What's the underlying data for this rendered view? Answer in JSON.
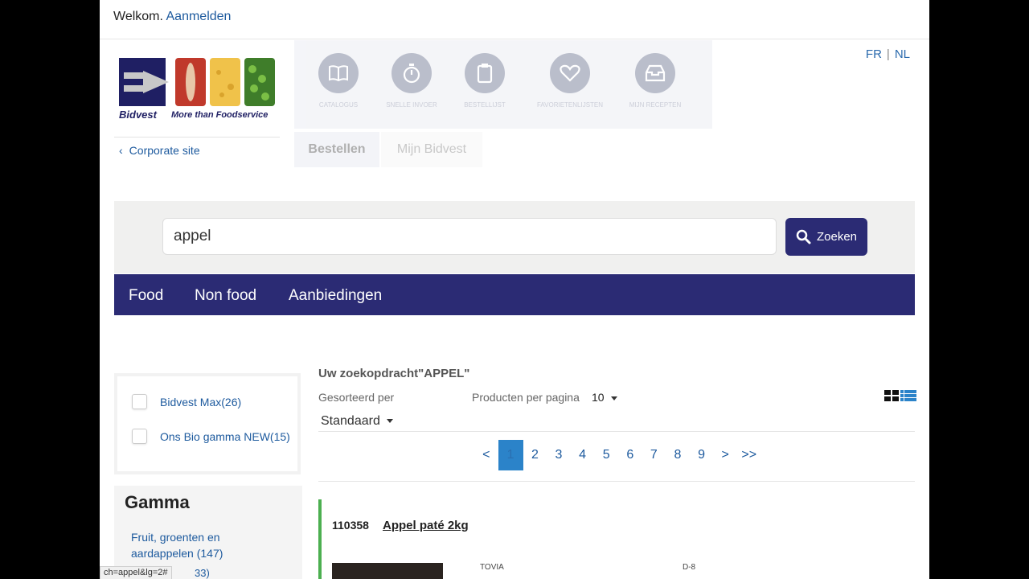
{
  "header": {
    "welcome": "Welkom.",
    "login_link": "Aanmelden"
  },
  "language": {
    "fr": "FR",
    "nl": "NL"
  },
  "logo": {
    "brand": "Bidvest",
    "tagline": "More than Foodservice"
  },
  "corporate_link": "Corporate site",
  "main_nav": [
    {
      "label": "CATALOGUS",
      "icon": "book-icon"
    },
    {
      "label": "SNELLE INVOER",
      "icon": "stopwatch-icon"
    },
    {
      "label": "BESTELLIJST",
      "icon": "clipboard-icon"
    },
    {
      "label": "FAVORIETENLIJSTEN",
      "icon": "heart-icon"
    },
    {
      "label": "MIJN RECEPTEN",
      "icon": "inbox-icon"
    }
  ],
  "tabs": {
    "order": "Bestellen",
    "my_account": "Mijn Bidvest"
  },
  "search": {
    "value": "appel",
    "button": "Zoeken"
  },
  "categories": [
    "Food",
    "Non food",
    "Aanbiedingen"
  ],
  "filters": [
    {
      "label": "Bidvest Max(26)",
      "checked": false
    },
    {
      "label": "Ons Bio gamma NEW(15)",
      "checked": false
    }
  ],
  "gamma": {
    "title": "Gamma",
    "items": [
      "Fruit, groenten en aardappelen (147)",
      "33)"
    ]
  },
  "results": {
    "title": "Uw zoekopdracht\"APPEL\"",
    "sort_label": "Gesorteerd per",
    "sort_value": "Standaard",
    "per_page_label": "Producten per pagina",
    "per_page_value": "10"
  },
  "pagination": {
    "prev": "<",
    "pages": [
      "1",
      "2",
      "3",
      "4",
      "5",
      "6",
      "7",
      "8",
      "9"
    ],
    "next": ">",
    "last": ">>",
    "active": "1"
  },
  "product": {
    "code": "110358",
    "name": "Appel paté 2kg",
    "brand": "TOVIA",
    "delivery": "D-8"
  },
  "status_url": "ch=appel&lg=2#",
  "colors": {
    "brand_navy": "#2b2b74",
    "link_blue": "#1d5a9e",
    "accent_green": "#4caf50",
    "active_page": "#2b83c9"
  }
}
